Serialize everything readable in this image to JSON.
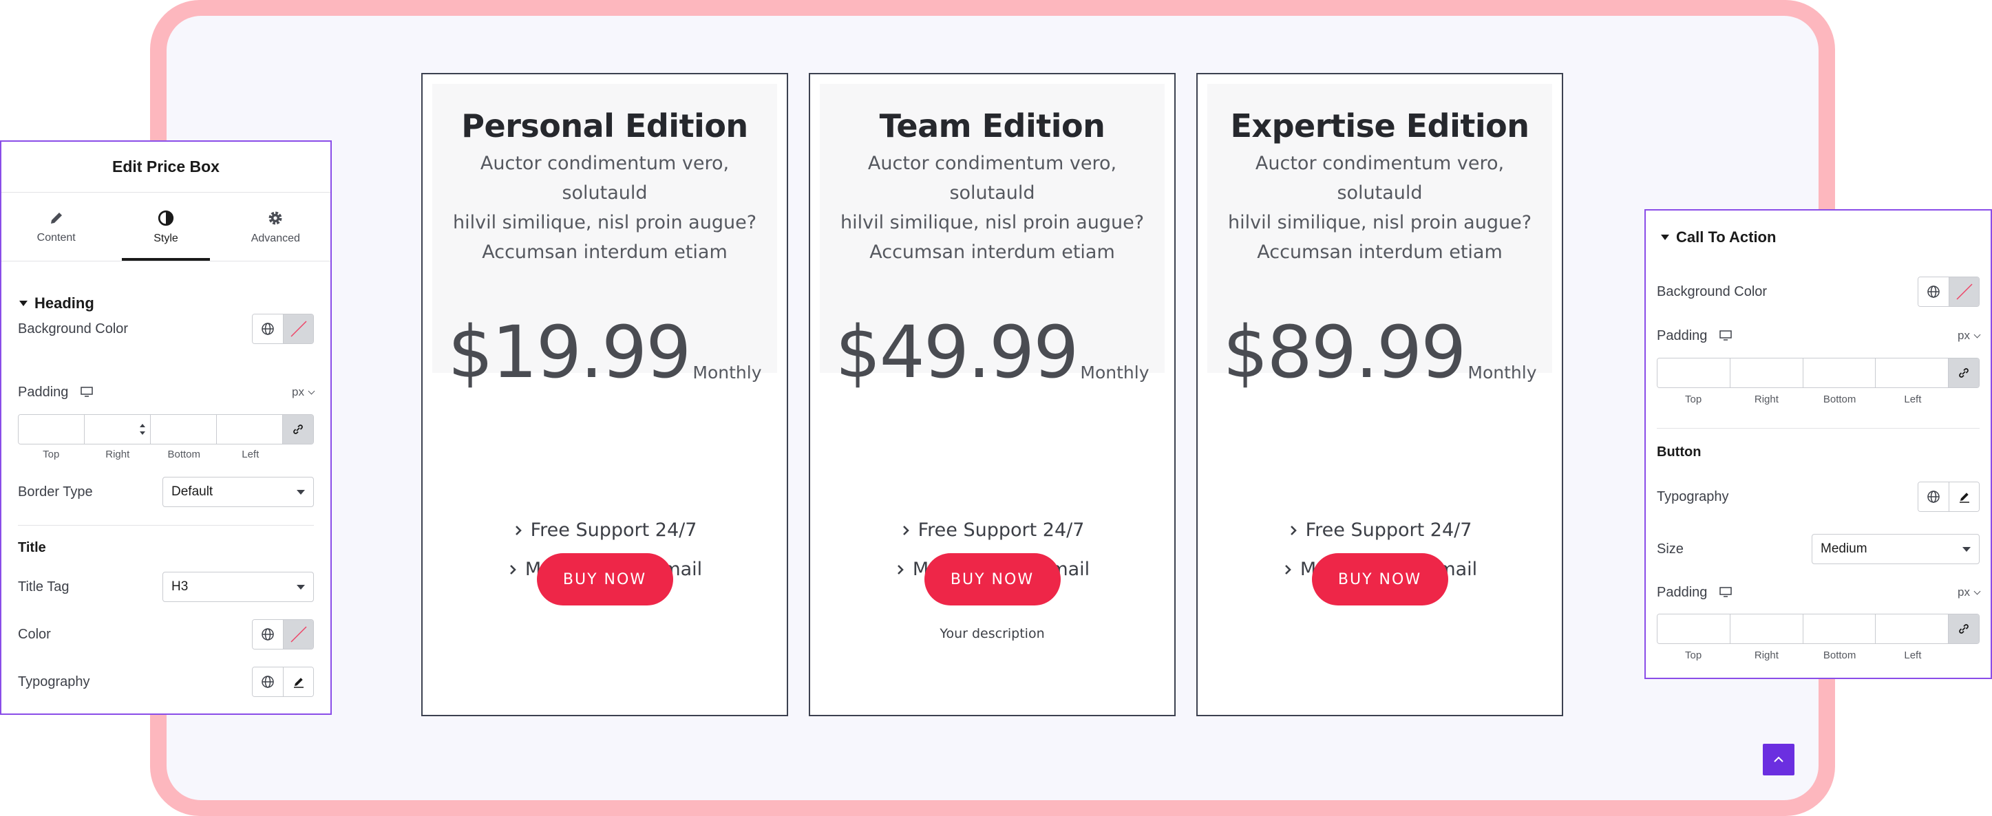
{
  "cards": [
    {
      "title": "Personal Edition",
      "desc": [
        "Auctor condimentum vero, solutauld",
        "hilvil similique, nisl proin augue?",
        "Accumsan interdum etiam"
      ],
      "price": "$19.99",
      "period": "Monthly",
      "features": [
        "Free Support 24/7",
        "Maintenance Email"
      ],
      "button": "BUY NOW",
      "sub": ""
    },
    {
      "title": "Team Edition",
      "desc": [
        "Auctor condimentum vero, solutauld",
        "hilvil similique, nisl proin augue?",
        "Accumsan interdum etiam"
      ],
      "price": "$49.99",
      "period": "Monthly",
      "features": [
        "Free Support 24/7",
        "Maintenance Email"
      ],
      "button": "BUY NOW",
      "sub": "Your description"
    },
    {
      "title": "Expertise Edition",
      "desc": [
        "Auctor condimentum vero, solutauld",
        "hilvil similique, nisl proin augue?",
        "Accumsan interdum etiam"
      ],
      "price": "$89.99",
      "period": "Monthly",
      "features": [
        "Free Support 24/7",
        "Maintenance Email"
      ],
      "button": "BUY NOW",
      "sub": ""
    }
  ],
  "left_panel": {
    "title": "Edit Price Box",
    "tabs": [
      {
        "label": "Content",
        "icon": "pencil-icon"
      },
      {
        "label": "Style",
        "icon": "contrast-icon"
      },
      {
        "label": "Advanced",
        "icon": "gear-icon"
      }
    ],
    "section": "Heading",
    "background_color": "Background Color",
    "padding": "Padding",
    "unit": "px",
    "dims": [
      "Top",
      "Right",
      "Bottom",
      "Left"
    ],
    "border_type": "Border Type",
    "border_value": "Default",
    "title_sub": "Title",
    "title_tag": "Title Tag",
    "title_tag_value": "H3",
    "color": "Color",
    "typography": "Typography"
  },
  "right_panel": {
    "section": "Call To Action",
    "background_color": "Background Color",
    "padding": "Padding",
    "unit": "px",
    "dims": [
      "Top",
      "Right",
      "Bottom",
      "Left"
    ],
    "button_sub": "Button",
    "typography": "Typography",
    "size": "Size",
    "size_value": "Medium",
    "padding2": "Padding",
    "unit2": "px"
  },
  "colors": {
    "accent": "#ee2648",
    "panel_border": "#8a4de8",
    "frame": "#fdb7be",
    "scroll_button": "#6b2fe0"
  }
}
